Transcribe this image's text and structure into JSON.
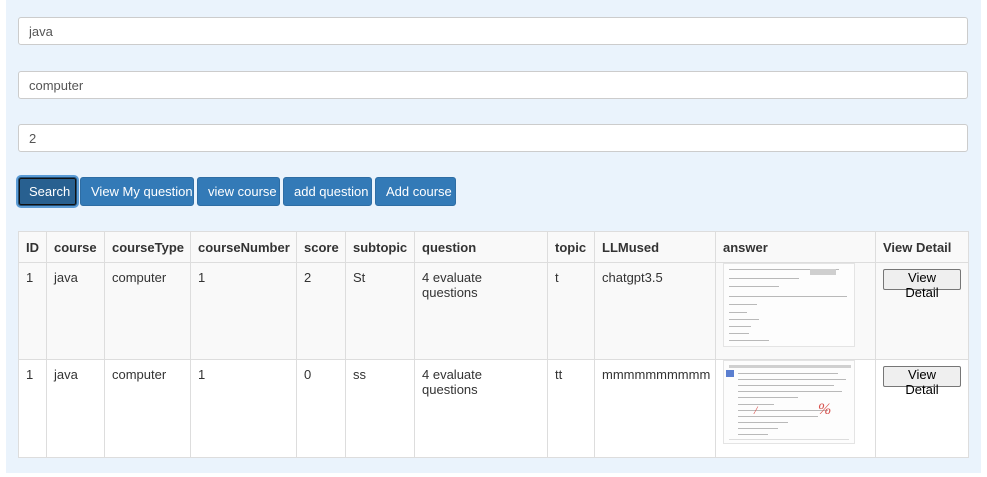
{
  "search": {
    "course_value": "java",
    "course_type_value": "computer",
    "course_number_value": "2"
  },
  "buttons": {
    "search": "Search",
    "view_my_question": "View My question",
    "view_course": "view course",
    "add_question": "add question",
    "add_course": "Add course"
  },
  "table": {
    "headers": [
      "ID",
      "course",
      "courseType",
      "courseNumber",
      "score",
      "subtopic",
      "question",
      "topic",
      "LLMused",
      "answer",
      "View Detail"
    ],
    "rows": [
      {
        "id": "1",
        "course": "java",
        "courseType": "computer",
        "courseNumber": "1",
        "score": "2",
        "subtopic": "St",
        "question": "4 evaluate questions",
        "topic": "t",
        "llmused": "chatgpt3.5",
        "detail_label": "View Detail"
      },
      {
        "id": "1",
        "course": "java",
        "courseType": "computer",
        "courseNumber": "1",
        "score": "0",
        "subtopic": "ss",
        "question": "4 evaluate questions",
        "topic": "tt",
        "llmused": "mmmmmmmmmm",
        "detail_label": "View Detail"
      }
    ]
  }
}
